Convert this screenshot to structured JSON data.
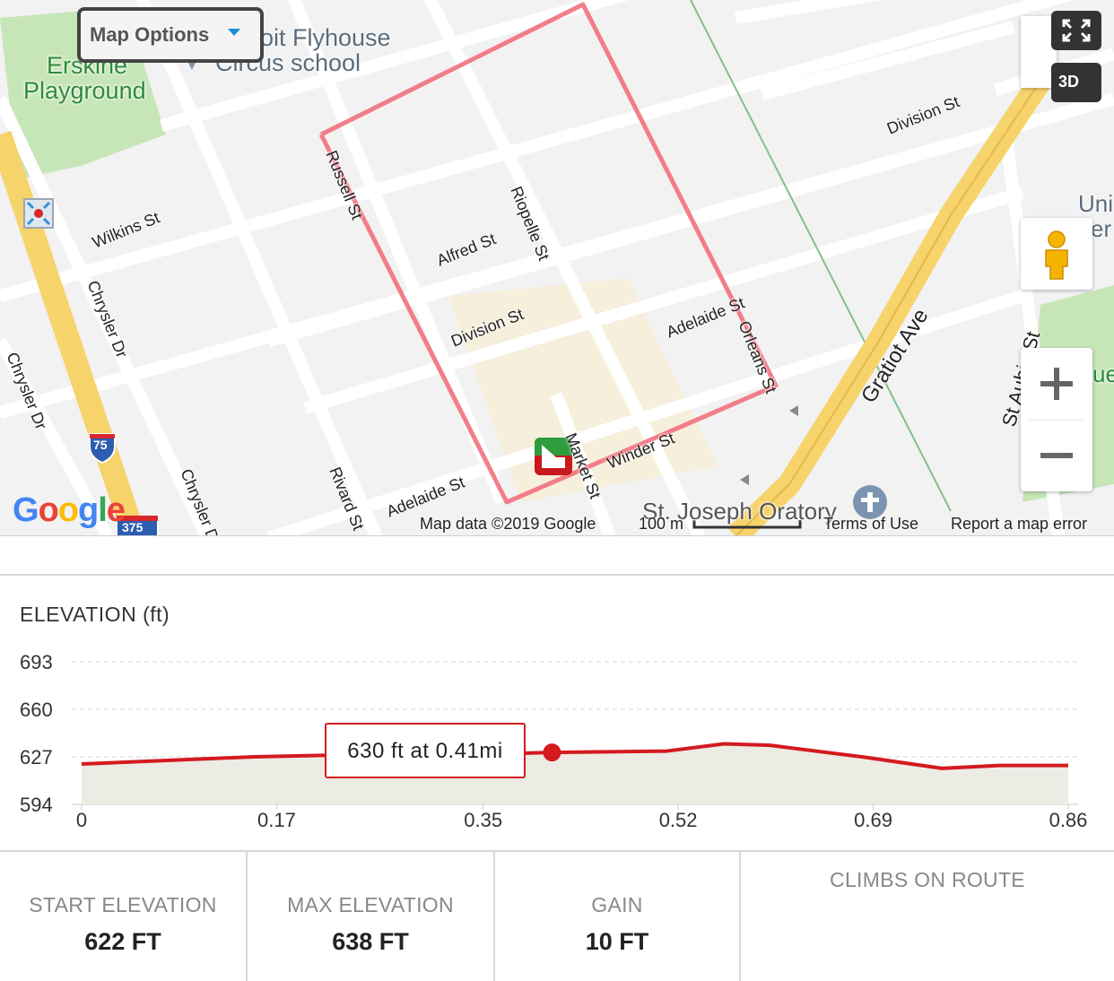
{
  "map": {
    "options_label": "Map Options",
    "btn_3d": "3D",
    "attribution": "Map data ©2019 Google",
    "scale": "100 m",
    "terms": "Terms of Use",
    "report": "Report a map error",
    "logo": "Google",
    "labels": {
      "erskine": "Erskine",
      "playground": "Playground",
      "flyhouse": "oit Flyhouse",
      "circus": "Circus school",
      "wilkins": "Wilkins St",
      "russell": "Russell St",
      "alfred": "Alfred St",
      "riopelle": "Riopelle St",
      "division1": "Division St",
      "division2": "Division St",
      "adelaide1": "Adelaide St",
      "adelaide2": "Adelaide St",
      "orleans": "Orleans St",
      "market": "Market St",
      "winder": "Winder St",
      "rivard": "Rivard St",
      "chrysler1": "Chrysler Dr",
      "chrysler2": "Chrysler Dr",
      "chrysler3": "Chrysler D",
      "gratiot": "Gratiot Ave",
      "staubin": "St Aubin St",
      "oratory": "St. Joseph Oratory",
      "uni": "Uni",
      "er": "er",
      "ue": "ue",
      "i75": "75",
      "i375": "375"
    },
    "colors": {
      "route": "#f2707c",
      "highway": "#f7d36b",
      "park": "#c7e6b8",
      "poi_area": "#f6efdc"
    }
  },
  "elevation": {
    "title": "ELEVATION (ft)",
    "tooltip": "630 ft at 0.41mi",
    "colors": {
      "line": "#d41a1f",
      "fill": "#ecebe4"
    }
  },
  "chart_data": {
    "type": "area",
    "title": "ELEVATION (ft)",
    "xlabel": "",
    "ylabel": "",
    "x_ticks": [
      "0",
      "0.17",
      "0.35",
      "0.52",
      "0.69",
      "0.86"
    ],
    "y_ticks": [
      "693",
      "660",
      "627",
      "594"
    ],
    "xlim": [
      0,
      0.86
    ],
    "ylim": [
      594,
      693
    ],
    "grid": true,
    "series": [
      {
        "x": [
          0,
          0.15,
          0.21,
          0.28,
          0.36,
          0.41,
          0.51,
          0.56,
          0.6,
          0.68,
          0.75,
          0.8,
          0.86
        ],
        "values": [
          622,
          627,
          628,
          628,
          629,
          630,
          631,
          636,
          635,
          627,
          619,
          621,
          621
        ]
      }
    ],
    "highlight": {
      "x": 0.41,
      "y": 630
    }
  },
  "stats": {
    "start_label": "START ELEVATION",
    "start_value": "622 FT",
    "max_label": "MAX ELEVATION",
    "max_value": "638 FT",
    "gain_label": "GAIN",
    "gain_value": "10 FT",
    "climbs_label": "CLIMBS ON ROUTE"
  }
}
